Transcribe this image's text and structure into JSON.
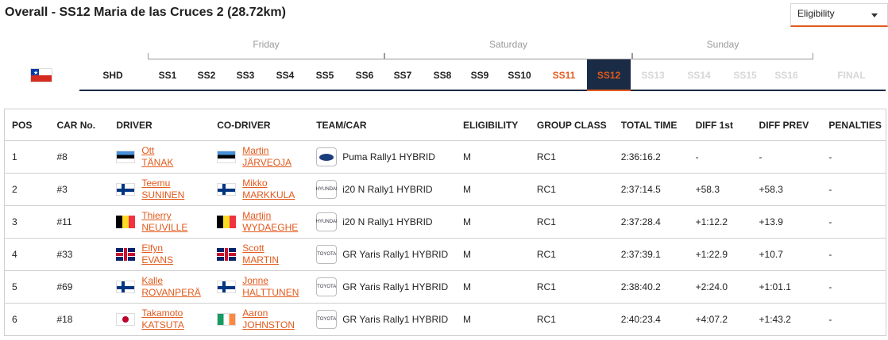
{
  "header": {
    "title": "Overall - SS12 Maria de las Cruces 2 (28.72km)",
    "eligibility_filter": "Eligibility"
  },
  "days": [
    "Friday",
    "Saturday",
    "Sunday"
  ],
  "stages": {
    "shd": "SHD",
    "items": [
      "SS1",
      "SS2",
      "SS3",
      "SS4",
      "SS5",
      "SS6",
      "SS7",
      "SS8",
      "SS9",
      "SS10",
      "SS11",
      "SS12",
      "SS13",
      "SS14",
      "SS15",
      "SS16"
    ],
    "final": "FINAL",
    "active": "SS12",
    "live": "SS11"
  },
  "country_flag": "chile-flag-icon",
  "table": {
    "columns": [
      "POS",
      "CAR No.",
      "DRIVER",
      "CO-DRIVER",
      "TEAM/CAR",
      "ELIGIBILITY",
      "GROUP CLASS",
      "TOTAL TIME",
      "DIFF 1st",
      "DIFF PREV",
      "PENALTIES"
    ],
    "rows": [
      {
        "pos": "1",
        "car": "#8",
        "driver_first": "Ott",
        "driver_last": "TÄNAK",
        "driver_flag": "ee",
        "codriver_first": "Martin",
        "codriver_last": "JÄRVEOJA",
        "codriver_flag": "ee",
        "brand": "ford-logo-icon",
        "team": "Puma Rally1 HYBRID",
        "elig": "M",
        "class": "RC1",
        "time": "2:36:16.2",
        "diff1": "-",
        "diffprev": "-",
        "pen": "-"
      },
      {
        "pos": "2",
        "car": "#3",
        "driver_first": "Teemu",
        "driver_last": "SUNINEN",
        "driver_flag": "fi",
        "codriver_first": "Mikko",
        "codriver_last": "MARKKULA",
        "codriver_flag": "fi",
        "brand": "hyundai-logo-icon",
        "team": "i20 N Rally1 HYBRID",
        "elig": "M",
        "class": "RC1",
        "time": "2:37:14.5",
        "diff1": "+58.3",
        "diffprev": "+58.3",
        "pen": "-"
      },
      {
        "pos": "3",
        "car": "#11",
        "driver_first": "Thierry",
        "driver_last": "NEUVILLE",
        "driver_flag": "be",
        "codriver_first": "Martijn",
        "codriver_last": "WYDAEGHE",
        "codriver_flag": "be",
        "brand": "hyundai-logo-icon",
        "team": "i20 N Rally1 HYBRID",
        "elig": "M",
        "class": "RC1",
        "time": "2:37:28.4",
        "diff1": "+1:12.2",
        "diffprev": "+13.9",
        "pen": "-"
      },
      {
        "pos": "4",
        "car": "#33",
        "driver_first": "Elfyn",
        "driver_last": "EVANS",
        "driver_flag": "gb",
        "codriver_first": "Scott",
        "codriver_last": "MARTIN",
        "codriver_flag": "gb",
        "brand": "toyota-logo-icon",
        "team": "GR Yaris Rally1 HYBRID",
        "elig": "M",
        "class": "RC1",
        "time": "2:37:39.1",
        "diff1": "+1:22.9",
        "diffprev": "+10.7",
        "pen": "-"
      },
      {
        "pos": "5",
        "car": "#69",
        "driver_first": "Kalle",
        "driver_last": "ROVANPERÄ",
        "driver_flag": "fi",
        "codriver_first": "Jonne",
        "codriver_last": "HALTTUNEN",
        "codriver_flag": "fi",
        "brand": "toyota-logo-icon",
        "team": "GR Yaris Rally1 HYBRID",
        "elig": "M",
        "class": "RC1",
        "time": "2:38:40.2",
        "diff1": "+2:24.0",
        "diffprev": "+1:01.1",
        "pen": "-"
      },
      {
        "pos": "6",
        "car": "#18",
        "driver_first": "Takamoto",
        "driver_last": "KATSUTA",
        "driver_flag": "jp",
        "codriver_first": "Aaron",
        "codriver_last": "JOHNSTON",
        "codriver_flag": "ie",
        "brand": "toyota-logo-icon",
        "team": "GR Yaris Rally1 HYBRID",
        "elig": "M",
        "class": "RC1",
        "time": "2:40:23.4",
        "diff1": "+4:07.2",
        "diffprev": "+1:43.2",
        "pen": "-"
      }
    ]
  },
  "brand_text": {
    "ford": "Ford",
    "hyundai": "HYUNDAI",
    "toyota": "TOYOTA"
  },
  "colors": {
    "accent": "#e25a1c",
    "navy": "#1a2b45"
  }
}
